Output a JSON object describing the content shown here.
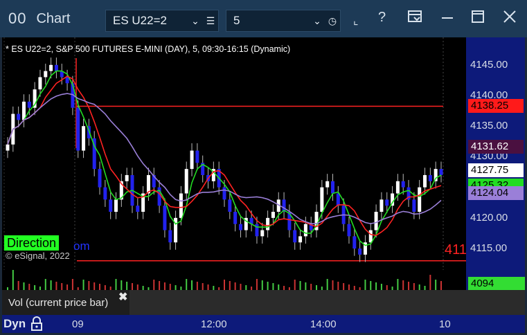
{
  "window": {
    "title": "Chart",
    "symbol": "ES U22=2",
    "interval": "5",
    "colors": {
      "titlebar": "#1d3a56",
      "chart_bg": "#000000",
      "axis_bg": "#0d1a7a"
    }
  },
  "toolbar_icons": [
    "link-icon",
    "help-icon",
    "template-icon",
    "minimize-icon",
    "maximize-icon",
    "close-icon"
  ],
  "chart_title": "* ES U22=2, S&P 500 FUTURES E-MINI (DAY), 5, 09:30-16:15 (Dynamic)",
  "direction_label": "Direction",
  "direction_suffix": "om",
  "right_cut_text": "411",
  "copyright": "© eSignal, 2022",
  "vol_label": "Vol (current price bar)",
  "time_axis": {
    "labels": [
      "Dyn",
      "09",
      "12:00",
      "14:00",
      "10"
    ]
  },
  "price_axis": {
    "ticks": [
      "4145.00",
      "4140.00",
      "4135.00",
      "4130.00",
      "4125.00",
      "4120.00",
      "4115.00"
    ],
    "tags": [
      {
        "value": "4138.25",
        "bg": "#ff1a1a",
        "fg": "#000000"
      },
      {
        "value": "4131.62",
        "bg": "#4a1040",
        "fg": "#ffffff"
      },
      {
        "value": "4127.75",
        "bg": "#ffffff",
        "fg": "#000000"
      },
      {
        "value": "4125.32",
        "bg": "#22dd22",
        "fg": "#000000"
      },
      {
        "value": "4124.04",
        "bg": "#9a7fd8",
        "fg": "#000000"
      }
    ],
    "vol_tag": {
      "value": "4094",
      "bg": "#33dd33",
      "fg": "#000000"
    }
  },
  "chart_data": {
    "type": "candlestick",
    "y_range": [
      4111.5,
      4149.5
    ],
    "levels": [
      {
        "name": "red-level-high",
        "value": 4138.25
      },
      {
        "name": "red-level-low",
        "value": 4113.0
      }
    ],
    "series": [
      {
        "name": "green-ma",
        "color": "#22dd22"
      },
      {
        "name": "red-ma",
        "color": "#ff2222"
      },
      {
        "name": "purple-ma",
        "color": "#9a7fd8"
      }
    ]
  }
}
